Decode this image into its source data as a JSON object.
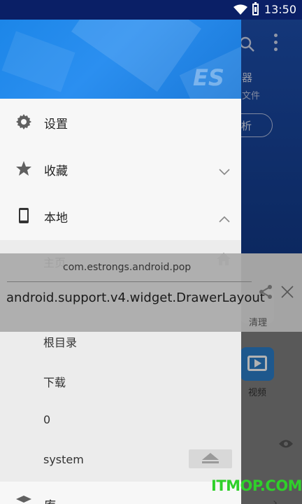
{
  "status_bar": {
    "time": "13:50"
  },
  "background_app": {
    "title_fragment": "器",
    "subtitle_fragment": "文件",
    "analyze_button_fragment": "析",
    "tiles": {
      "clean": "清理",
      "video": "视频"
    }
  },
  "drawer": {
    "menu": [
      {
        "label": "设置",
        "icon": "gear-icon"
      },
      {
        "label": "收藏",
        "icon": "star-icon",
        "expanded": false
      },
      {
        "label": "本地",
        "icon": "phone-icon",
        "expanded": true
      }
    ],
    "local_items": [
      "主页",
      "根目录",
      "下载",
      "0",
      "system"
    ],
    "library_label": "库"
  },
  "popup": {
    "package": "com.estrongs.android.pop",
    "class_name": "android.support.v4.widget.DrawerLayout"
  },
  "watermark": "ITMOP.COM",
  "colors": {
    "status_bar": "#0a1f66",
    "drawer_header": "#1c86e8",
    "app_header": "#1d4fae",
    "watermark": "#2fd02a"
  }
}
